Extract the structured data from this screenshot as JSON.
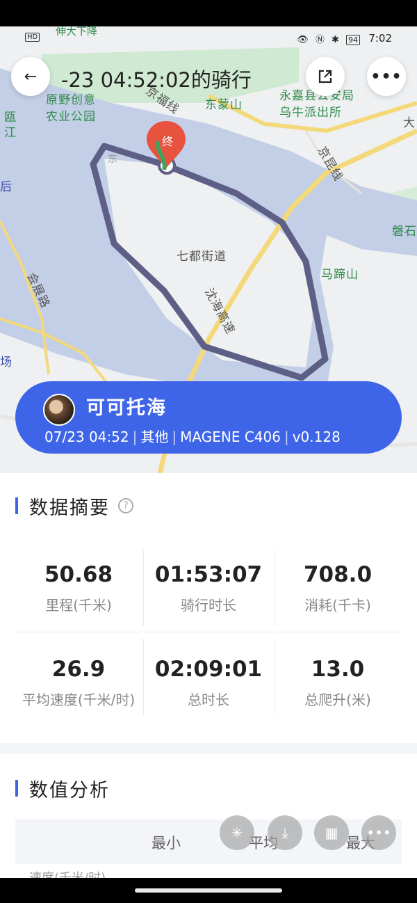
{
  "status_bar": {
    "time": "7:02",
    "battery": "94",
    "hd": "HD",
    "icons": "👁 Ⓝ ✱",
    "clipped_text": "伸大下降"
  },
  "header": {
    "title": "-23 04:52:02的骑行"
  },
  "map": {
    "labels": {
      "farm": "原野创意\n农业公园",
      "jingfu": "京福线",
      "dongmeng": "东蒙山",
      "police": "永嘉县公安局\n乌牛派出所",
      "da": "大",
      "jiang": "瓯\n江",
      "hou": "后",
      "hui_zhan": "会展路",
      "chang": "场",
      "qidu": "七都街道",
      "shenhai": "沈海高速",
      "mati": "马蹄山",
      "panshi": "磐石",
      "dongjie": "东",
      "jingkun": "京昆线",
      "end_marker": "终"
    },
    "colors": {
      "water": "#c3cfe6",
      "land": "#eef0f2",
      "park": "#cfe9d2",
      "road": "#f4d97a",
      "route": "#5d5f86",
      "marker": "#e8533f"
    }
  },
  "rider": {
    "name": "可可托海",
    "date": "07/23 04:52",
    "type": "其他",
    "device": "MAGENE C406",
    "version": "v0.128",
    "separator": "|"
  },
  "summary": {
    "title": "数据摘要",
    "help": "?",
    "stats": [
      {
        "value": "50.68",
        "label": "里程(千米)"
      },
      {
        "value": "01:53:07",
        "label": "骑行时长"
      },
      {
        "value": "708.0",
        "label": "消耗(千卡)"
      },
      {
        "value": "26.9",
        "label": "平均速度(千米/时)"
      },
      {
        "value": "02:09:01",
        "label": "总时长"
      },
      {
        "value": "13.0",
        "label": "总爬升(米)"
      }
    ]
  },
  "analysis": {
    "title": "数值分析",
    "columns": [
      "最小",
      "平均",
      "最大"
    ],
    "first_row_label": "速度(千米/时)"
  }
}
